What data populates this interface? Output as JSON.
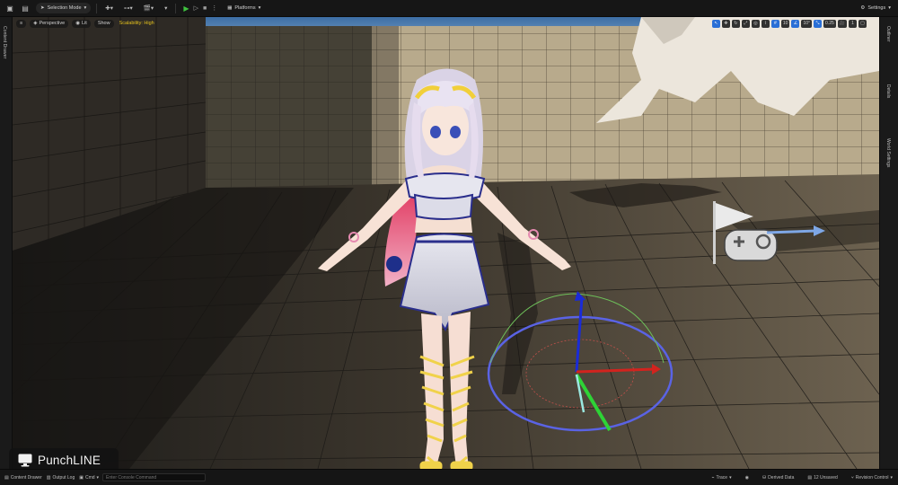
{
  "toolbar": {
    "selection_mode": "Selection Mode",
    "platforms": "Platforms",
    "settings": "Settings"
  },
  "side_tabs": {
    "content_drawer": "Content Drawer",
    "outliner": "Outliner",
    "details": "Details",
    "world_settings": "World Settings"
  },
  "viewport": {
    "perspective": "Perspective",
    "lit": "Lit",
    "show": "Show",
    "scalability": "Scalability: High",
    "grid_snap": "10",
    "rotation_snap": "10°",
    "scale_snap": "0.25",
    "camera_speed": "1"
  },
  "watermark": {
    "text": "PunchLINE"
  },
  "statusbar": {
    "content_drawer": "Content Drawer",
    "output_log": "Output Log",
    "cmd": "Cmd",
    "cmd_placeholder": "Enter Console Command",
    "trace": "Trace",
    "derived_data": "Derived Data",
    "unsaved": "12 Unsaved",
    "revision_control": "Revision Control"
  },
  "icons": [
    "save-icon",
    "content-icon",
    "mode-icon",
    "add-icon",
    "play-icon",
    "flag-icon",
    "gamepad-icon",
    "gizmo-icon",
    "monitor-icon"
  ]
}
